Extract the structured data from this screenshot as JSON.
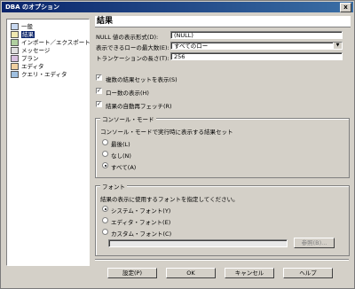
{
  "window": {
    "title": "DBA のオプション",
    "close": "x"
  },
  "tree": {
    "items": [
      {
        "label": "一般",
        "icon": "general-icon"
      },
      {
        "label": "結果",
        "icon": "results-icon",
        "selected": true
      },
      {
        "label": "インポート／エクスポート",
        "icon": "import-export-icon"
      },
      {
        "label": "メッセージ",
        "icon": "messages-icon"
      },
      {
        "label": "プラン",
        "icon": "plan-icon"
      },
      {
        "label": "エディタ",
        "icon": "editor-icon"
      },
      {
        "label": "クエリ・エディタ",
        "icon": "query-editor-icon"
      }
    ]
  },
  "panel": {
    "title": "結果",
    "null_label": "NULL 値の表示形式(D):",
    "null_value": "(NULL)",
    "maxrows_label": "表示できるローの最大数(E):",
    "maxrows_value": "すべてのロー",
    "trunc_label": "トランケーションの長さ(T):",
    "trunc_value": "256",
    "checks": [
      {
        "label": "複数の結果セットを表示(S)",
        "checked": true
      },
      {
        "label": "ロー数の表示(H)",
        "checked": true
      },
      {
        "label": "結果の自動再フェッチ(R)",
        "checked": true
      }
    ],
    "console": {
      "title": "コンソール・モード",
      "desc": "コンソール・モードで実行時に表示する結果セット",
      "options": [
        {
          "label": "最後(L)",
          "selected": false
        },
        {
          "label": "なし(N)",
          "selected": false
        },
        {
          "label": "すべて(A)",
          "selected": true
        }
      ]
    },
    "font": {
      "title": "フォント",
      "desc": "結果の表示に使用するフォントを指定してください。",
      "options": [
        {
          "label": "システム・フォント(Y)",
          "selected": true
        },
        {
          "label": "エディタ・フォント(E)",
          "selected": false
        },
        {
          "label": "カスタム・フォント(C)",
          "selected": false
        }
      ],
      "browse": "参照(B)..."
    }
  },
  "buttons": {
    "settings": "設定(P)",
    "ok": "OK",
    "cancel": "キャンセル",
    "help": "ヘルプ"
  }
}
